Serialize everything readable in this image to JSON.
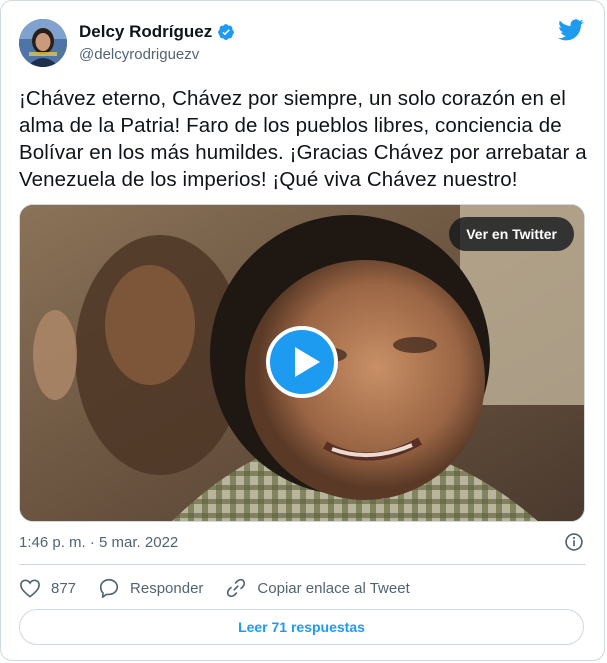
{
  "author": {
    "name": "Delcy Rodríguez",
    "handle": "@delcyrodriguezv",
    "verified": true,
    "avatar_icon": "avatar-photo"
  },
  "tweet": {
    "text": "¡Chávez eterno, Chávez por siempre, un solo corazón en el alma de la Patria! Faro de los pueblos libres, conciencia de Bolívar en los más humildes. ¡Gracias Chávez por arrebatar a Venezuela de los imperios! ¡Qué viva Chávez nuestro!",
    "timestamp": "1:46 p. m. · 5 mar. 2022"
  },
  "media": {
    "view_on_twitter_label": "Ver en Twitter",
    "play_icon": "play-icon"
  },
  "actions": {
    "like_count": "877",
    "reply_label": "Responder",
    "copy_link_label": "Copiar enlace al Tweet"
  },
  "read_replies_label": "Leer 71 respuestas",
  "colors": {
    "accent": "#1d9bf0",
    "text": "#0f1419",
    "secondary": "#536471",
    "border": "#cfd9de"
  }
}
